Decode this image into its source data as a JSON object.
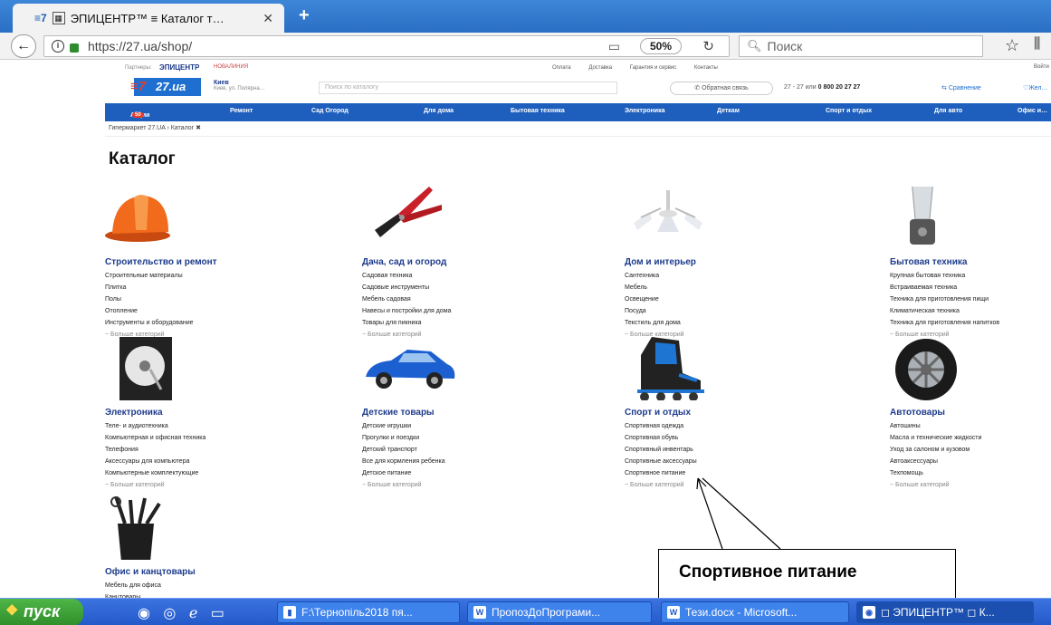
{
  "browser": {
    "tab_title": "ЭПИЦЕНТР™ ≡ Каталог т…",
    "tab_close": "✕",
    "new_tab": "+",
    "url": "https://27.ua/shop/",
    "zoom": "50%",
    "search_placeholder": "Поиск"
  },
  "site": {
    "partners_label": "Партнеры:",
    "partner1": "ЭПИЦЕНТР",
    "partner2": "НОВАЛИНИЯ",
    "top_links": [
      "Оплата",
      "Доставка",
      "Гарантия и сервис",
      "Контакты"
    ],
    "login": "Войти",
    "logo_text": "27.ua",
    "city": "Киев",
    "city_address": "Киев, ул. Полярна…",
    "search_placeholder": "Поиск по каталогу",
    "callback": "Обратная связь",
    "phone_prefix": "27 - 27 или",
    "phone": "0 800 20 27 27",
    "compare": "Сравнение",
    "wishlist": "Жел…"
  },
  "nav": {
    "items": [
      "Акции",
      "Ремонт",
      "Сад Огород",
      "Для дома",
      "Бытовая техника",
      "Электроника",
      "Деткам",
      "Спорт и отдых",
      "Для авто",
      "Офис и…"
    ],
    "promo_badge": "50"
  },
  "breadcrumb": "Гипермаркет 27.UA ›  Каталог ✖",
  "page_title": "Каталог",
  "categories": [
    {
      "title": "Строительство и ремонт",
      "items": [
        "Строительные материалы",
        "Плитка",
        "Полы",
        "Отопление",
        "Инструменты и оборудование"
      ],
      "more": "− Больше категорий",
      "icon": "hard-hat-icon"
    },
    {
      "title": "Дача, сад и огород",
      "items": [
        "Садовая техника",
        "Садовые инструменты",
        "Мебель садовая",
        "Навесы и постройки для дома",
        "Товары для пикника"
      ],
      "more": "− Больше категорий",
      "icon": "pruner-icon"
    },
    {
      "title": "Дом и интерьер",
      "items": [
        "Сантехника",
        "Мебель",
        "Освещение",
        "Посуда",
        "Текстиль для дома"
      ],
      "more": "− Больше категорий",
      "icon": "chandelier-icon"
    },
    {
      "title": "Бытовая техника",
      "items": [
        "Крупная бытовая техника",
        "Встраиваемая техника",
        "Техника для приготовления пищи",
        "Климатическая техника",
        "Техника для приготовления напитков"
      ],
      "more": "− Больше категорий",
      "icon": "blender-icon"
    },
    {
      "title": "Электроника",
      "items": [
        "Теле- и аудиотехника",
        "Компьютерная и офисная техника",
        "Телефония",
        "Аксессуары для компьютера",
        "Компьютерные комплектующие"
      ],
      "more": "− Больше категорий",
      "icon": "hard-drive-icon"
    },
    {
      "title": "Детские товары",
      "items": [
        "Детские игрушки",
        "Прогулки и поездки",
        "Детский транспорт",
        "Все для кормления ребенка",
        "Детское питание"
      ],
      "more": "− Больше категорий",
      "icon": "toy-car-icon"
    },
    {
      "title": "Спорт и отдых",
      "items": [
        "Спортивная одежда",
        "Спортивная обувь",
        "Спортивный инвентарь",
        "Спортивные аксессуары",
        "Спортивное питание"
      ],
      "more": "− Больше категорий",
      "icon": "roller-skate-icon"
    },
    {
      "title": "Автотовары",
      "items": [
        "Автошины",
        "Масла и технические жидкости",
        "Уход за салоном и кузовом",
        "Автоаксессуары",
        "Техпомощь"
      ],
      "more": "− Больше категорий",
      "icon": "tire-icon"
    },
    {
      "title": "Офис и канцтовары",
      "items": [
        "Мебель для офиса",
        "Канцтовары"
      ],
      "more": "",
      "icon": "pen-holder-icon"
    }
  ],
  "callout": "Спортивное питание",
  "taskbar": {
    "start": "пуск",
    "tasks": [
      "F:\\Тернопіль2018 пя...",
      "ПропозДоПрограми...",
      "Тези.docx - Microsoft...",
      "◻ ЭПИЦЕНТР™ ◻ К..."
    ]
  },
  "colors": {
    "accent": "#1e5fbe",
    "link": "#1d3b8c",
    "logo_red": "#e53c2b"
  }
}
